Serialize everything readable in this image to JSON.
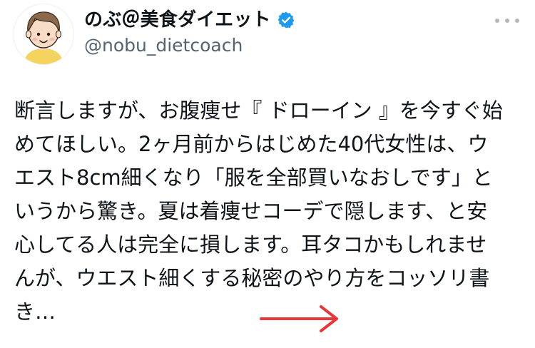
{
  "author": {
    "display_name": "のぶ＠美食ダイエット",
    "handle": "@nobu_dietcoach",
    "verified_icon": "verified-badge-icon",
    "avatar_icon": "cartoon-man-avatar"
  },
  "menu": {
    "icon": "more-options-icon"
  },
  "tweet": {
    "lines": [
      "断言しますが、お腹痩せ『 ドローイン 』を今すぐ始",
      "めてほしい。2ヶ月前からはじめた40代女性は、ウ",
      "エスト8cm細くなり「服を全部買いなおしです」と",
      "いうから驚き。夏は着痩せコーデで隠します、と安",
      "心してる人は完全に損します。耳タコかもしれませ",
      "んが、ウエスト細くする秘密のやり方をコッソリ書",
      "き…"
    ]
  },
  "annotation": {
    "icon": "red-arrow-icon",
    "color": "#e5383b"
  },
  "colors": {
    "verified": "#1d9bf0",
    "handle": "#536471",
    "text": "#0f1419"
  }
}
